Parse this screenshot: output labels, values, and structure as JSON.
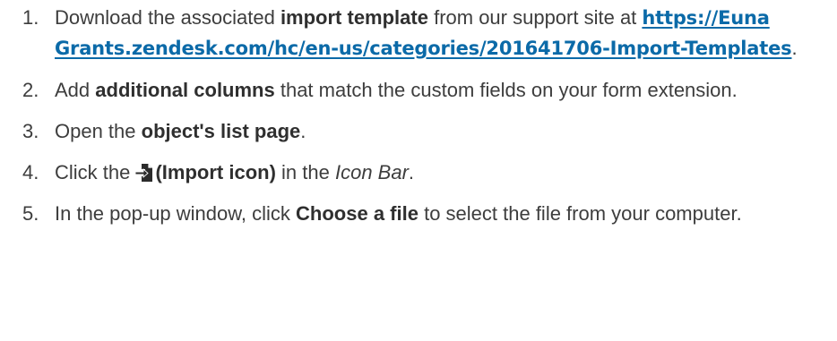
{
  "steps": [
    {
      "number": "1.",
      "text_a": "Download the associated ",
      "bold_a": "import template",
      "text_b": " from our support site at ",
      "link": "https://Euna Grants.zendesk.com/hc/en-us/categories/201641706-Import-Templates",
      "text_c": "."
    },
    {
      "number": "2.",
      "text_a": "Add ",
      "bold_a": "additional columns",
      "text_b": " that match the custom fields on your form extension."
    },
    {
      "number": "3.",
      "text_a": "Open the ",
      "bold_a": "object's list page",
      "text_b": "."
    },
    {
      "number": "4.",
      "text_a": "Click the ",
      "icon": "import-icon",
      "bold_a": "(Import icon)",
      "text_b": " in the ",
      "italic_a": "Icon Bar",
      "text_c": "."
    },
    {
      "number": "5.",
      "text_a": "In the pop-up window, click ",
      "bold_a": "Choose a file",
      "text_b": " to select the file from your computer."
    }
  ]
}
